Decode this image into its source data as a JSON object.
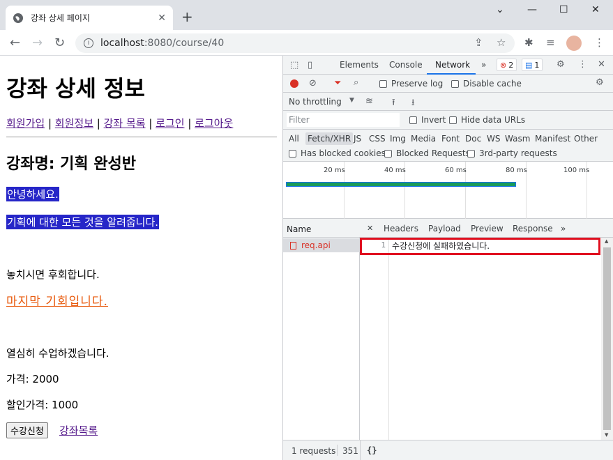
{
  "browser": {
    "tab_title": "강좌 상세 페이지",
    "new_tab": "+",
    "url_host": "localhost",
    "url_path": ":8080/course/40",
    "win_min": "⌄",
    "win_minimize": "—",
    "win_maximize": "☐",
    "win_close": "✕"
  },
  "page": {
    "title": "강좌 상세 정보",
    "nav": [
      "회원가입",
      "회원정보",
      "강좌 목록",
      "로그인",
      "로그아웃"
    ],
    "nav_sep": " | ",
    "course_name": "강좌명: 기획 완성반",
    "greeting": "안녕하세요.",
    "intro": "기획에 대한 모든 것을 알려줍니다.",
    "regret": "놓치시면 후회합니다.",
    "last_chance": "마지막 기회입니다.",
    "study": "열심히 수업하겠습니다.",
    "price": "가격: 2000",
    "discount_price": "할인가격: 1000",
    "enroll_button": "수강신청",
    "course_list_link": "강좌목록"
  },
  "devtools": {
    "tabs": [
      "Elements",
      "Console",
      "Network"
    ],
    "active_tab": "Network",
    "more": "»",
    "errors": "2",
    "messages": "1",
    "preserve_log": "Preserve log",
    "disable_cache": "Disable cache",
    "throttling": "No throttling",
    "filter_placeholder": "Filter",
    "invert": "Invert",
    "hide_data_urls": "Hide data URLs",
    "types": [
      "All",
      "Fetch/XHR",
      "JS",
      "CSS",
      "Img",
      "Media",
      "Font",
      "Doc",
      "WS",
      "Wasm",
      "Manifest",
      "Other"
    ],
    "active_type": "Fetch/XHR",
    "has_blocked_cookies": "Has blocked cookies",
    "blocked_requests": "Blocked Requests",
    "third_party": "3rd-party requests",
    "timeline_ticks": [
      "20 ms",
      "40 ms",
      "60 ms",
      "80 ms",
      "100 ms"
    ],
    "name_header": "Name",
    "request_name": "req.api",
    "detail_tabs": [
      "Headers",
      "Payload",
      "Preview",
      "Response"
    ],
    "response_line_no": "1",
    "response_text": "수강신청에 실패하였습니다.",
    "status_requests": "1 requests",
    "status_size": "351",
    "format_button": "{}"
  },
  "colors": {
    "highlight_bg": "#2626c8",
    "orange_text": "#e8590c",
    "link": "#551a8b",
    "error_red": "#d93025",
    "box_red": "#e01020",
    "accent_blue": "#1a73e8"
  }
}
